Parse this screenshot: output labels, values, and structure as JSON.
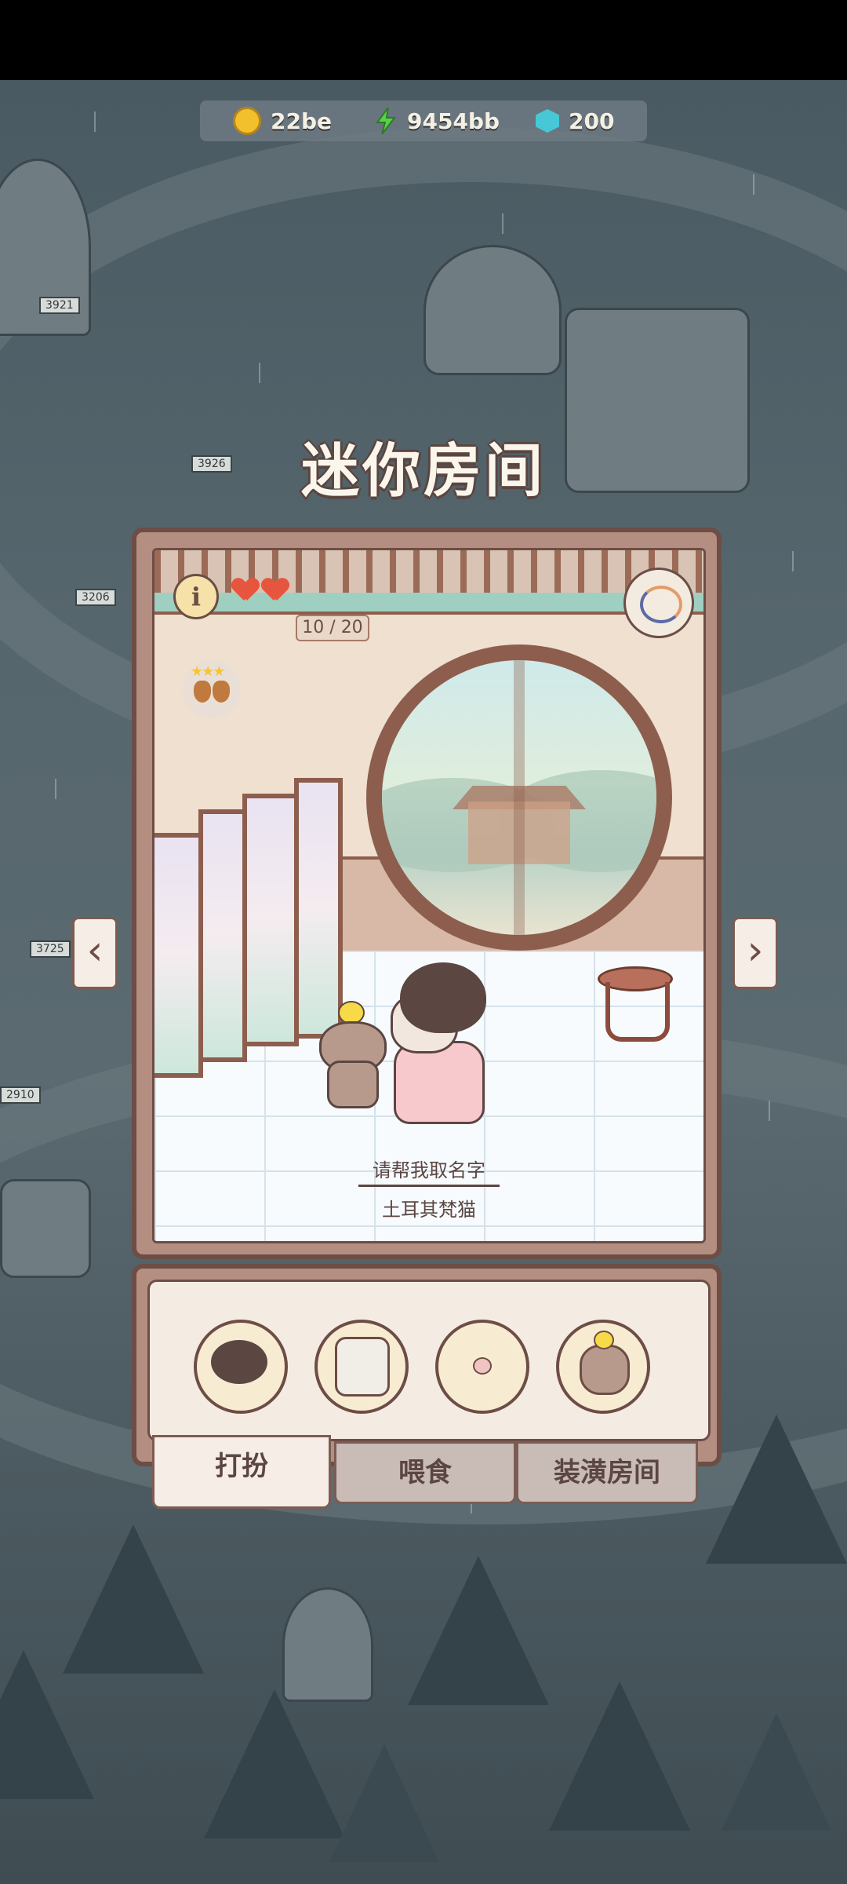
{
  "currency": {
    "coins": "22be",
    "energy": "9454bb",
    "gems": "200",
    "coin_icon": "coin-icon",
    "energy_icon": "lightning-icon",
    "gem_icon": "gem-icon"
  },
  "title": "迷你房间",
  "room": {
    "info_label": "i",
    "hearts": 2,
    "counter": "10 / 20",
    "stars": "★★★",
    "name_prompt": "请帮我取名字",
    "breed": "土耳其梵猫"
  },
  "nav": {
    "prev": "‹",
    "next": "›"
  },
  "items": [
    {
      "icon": "wig-icon"
    },
    {
      "icon": "outfit-icon"
    },
    {
      "icon": "nose-icon"
    },
    {
      "icon": "puppy-pet-icon"
    }
  ],
  "tabs": [
    {
      "label": "打扮",
      "active": true
    },
    {
      "label": "喂食",
      "active": false
    },
    {
      "label": "装潢房间",
      "active": false
    }
  ],
  "colors": {
    "frame": "#b48e80",
    "frame_border": "#6d4d45",
    "tab_active": "#f6eee6",
    "tab_inactive": "#c9bbb6"
  }
}
